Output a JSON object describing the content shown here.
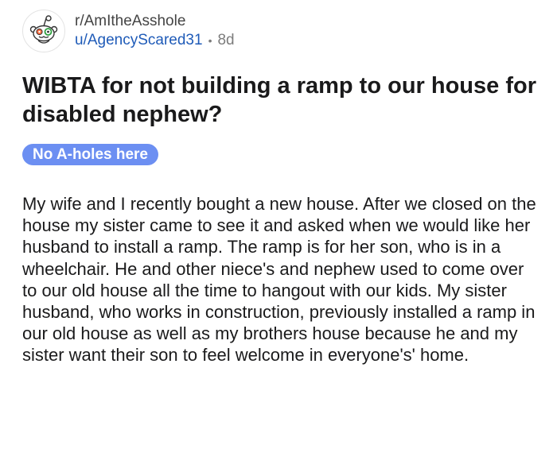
{
  "post": {
    "subreddit": "r/AmItheAsshole",
    "author": "u/AgencyScared31",
    "separator": "•",
    "age": "8d",
    "title": "WIBTA for not building a ramp to our house for disabled nephew?",
    "flair": "No A-holes here",
    "body": "My wife and I recently bought a new house. After we closed on the house my sister came to see it and asked when we would like her husband to install a ramp. The ramp is for her son, who is in a wheelchair. He and other niece's and nephew used to come over to our old house all the time to hangout with our kids. My sister husband, who works in construction, previously installed a ramp in our old house as well as my brothers house because he and my sister want their son to feel welcome in everyone's' home."
  },
  "icons": {
    "avatar": "snoo-avatar-icon"
  },
  "colors": {
    "username": "#1f5bb8",
    "flair_background": "#6c8ff2",
    "flair_text": "#ffffff",
    "muted": "#7c7c7c"
  }
}
